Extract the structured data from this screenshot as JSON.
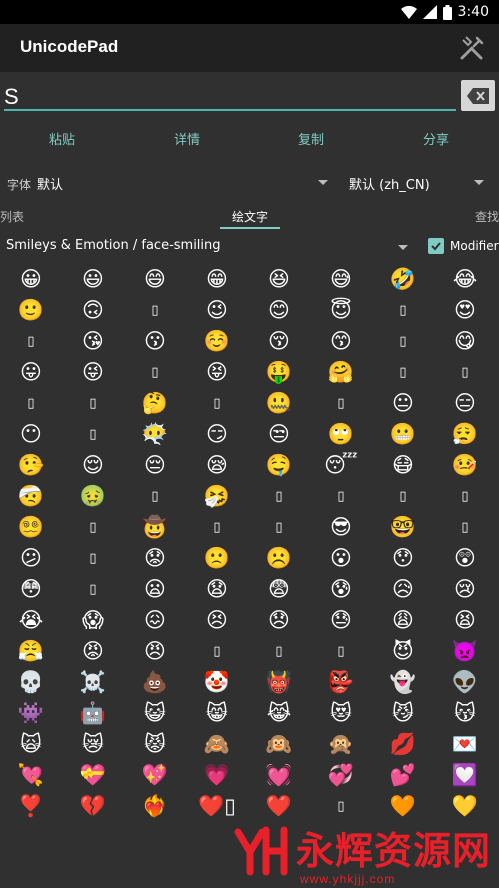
{
  "status_bar": {
    "time": "3:40"
  },
  "app_bar": {
    "title": "UnicodePad",
    "tools_icon": "wrench-screwdriver-icon"
  },
  "input": {
    "value": "S",
    "backspace_icon": "backspace-icon"
  },
  "actions": [
    {
      "label": "粘贴"
    },
    {
      "label": "详情"
    },
    {
      "label": "复制"
    },
    {
      "label": "分享"
    }
  ],
  "font": {
    "label": "字体",
    "value": "默认",
    "locale": "默认 (zh_CN)"
  },
  "tabs": [
    {
      "label": "列表"
    },
    {
      "label": "绘文字"
    },
    {
      "label": "查找"
    }
  ],
  "category": {
    "selected": "Smileys & Emotion / face-smiling",
    "modifier_label": "Modifier",
    "modifier_checked": true
  },
  "emoji_rows": [
    [
      "😀",
      "😃",
      "😄",
      "😁",
      "😆",
      "😅",
      "🤣",
      "😂"
    ],
    [
      "🙂",
      "🙃",
      "▯",
      "😉",
      "😊",
      "😇",
      "▯",
      "😍"
    ],
    [
      "▯",
      "😘",
      "😗",
      "☺️",
      "😚",
      "😙",
      "▯",
      "😋"
    ],
    [
      "😛",
      "😜",
      "▯",
      "😝",
      "🤑",
      "🤗",
      "▯",
      "▯"
    ],
    [
      "▯",
      "▯",
      "🤔",
      "▯",
      "🤐",
      "▯",
      "😐",
      "😑"
    ],
    [
      "😶",
      "▯",
      "😶‍🌫️",
      "😏",
      "😒",
      "🙄",
      "😬",
      "😮‍💨"
    ],
    [
      "🤥",
      "😌",
      "😔",
      "😪",
      "🤤",
      "😴",
      "😷",
      "🤒"
    ],
    [
      "🤕",
      "🤢",
      "▯",
      "🤧",
      "▯",
      "▯",
      "▯",
      "▯"
    ],
    [
      "😵‍💫",
      "▯",
      "🤠",
      "▯",
      "▯",
      "😎",
      "🤓",
      "▯"
    ],
    [
      "😕",
      "▯",
      "😟",
      "🙁",
      "☹️",
      "😮",
      "😯",
      "😲"
    ],
    [
      "😳",
      "▯",
      "😦",
      "😧",
      "😨",
      "😰",
      "😥",
      "😢"
    ],
    [
      "😭",
      "😱",
      "😖",
      "😣",
      "😞",
      "😓",
      "😩",
      "😫"
    ],
    [
      "😤",
      "😡",
      "😠",
      "▯",
      "▯",
      "▯",
      "😈",
      "👿"
    ],
    [
      "💀",
      "☠️",
      "💩",
      "🤡",
      "👹",
      "👺",
      "👻",
      "👽"
    ],
    [
      "👾",
      "🤖",
      "😺",
      "😸",
      "😹",
      "😻",
      "😼",
      "😽"
    ],
    [
      "🙀",
      "😿",
      "😾",
      "🙈",
      "🙉",
      "🙊",
      "💋",
      "💌"
    ],
    [
      "💘",
      "💝",
      "💖",
      "💗",
      "💓",
      "💞",
      "💕",
      "💟"
    ],
    [
      "❣️",
      "💔",
      "❤️‍🔥",
      "❤️‍▯",
      "❤️",
      "▯",
      "🧡",
      "💛"
    ]
  ],
  "watermark": {
    "text": "永辉资源网",
    "url": "www.yhkjjj.com"
  }
}
